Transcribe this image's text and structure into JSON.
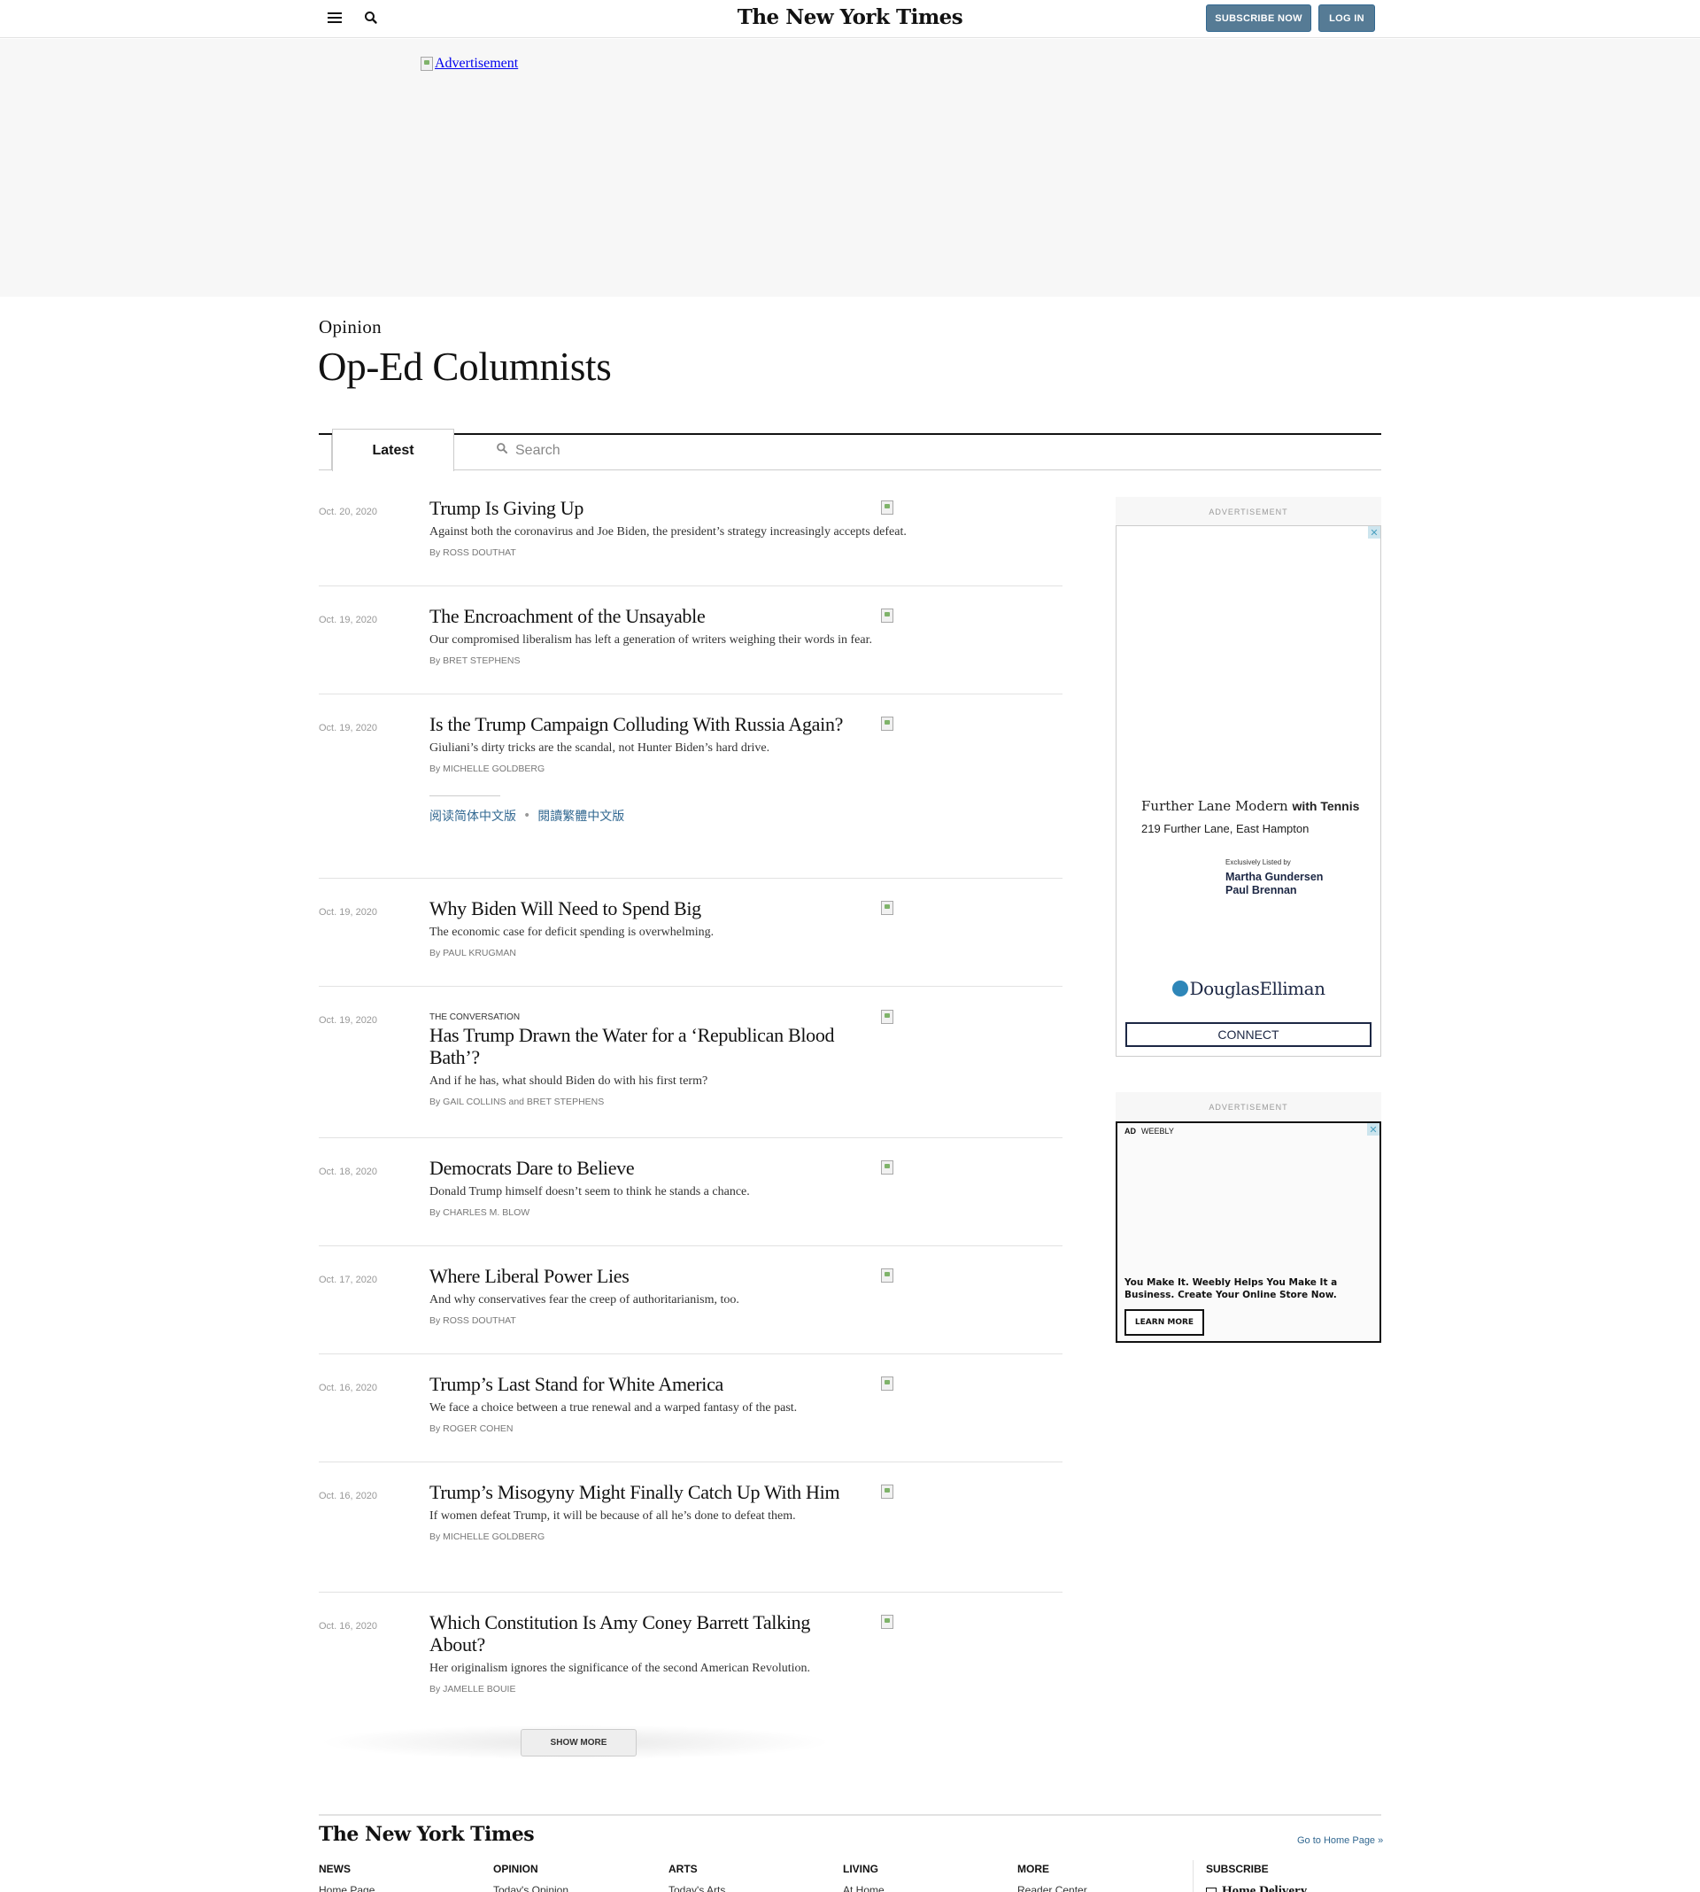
{
  "header": {
    "logo": "The New York Times",
    "subscribe_label": "SUBSCRIBE NOW",
    "login_label": "LOG IN"
  },
  "top_ad": {
    "alt": "Advertisement"
  },
  "section": {
    "kicker": "Opinion",
    "title": "Op-Ed Columnists"
  },
  "tabs": {
    "latest": "Latest",
    "search_placeholder": "Search"
  },
  "articles": [
    {
      "date": "Oct. 20, 2020",
      "label": "",
      "title": "Trump Is Giving Up",
      "summary": "Against both the coronavirus and Joe Biden, the president’s strategy increasingly accepts defeat.",
      "byline": "By ROSS DOUTHAT"
    },
    {
      "date": "Oct. 19, 2020",
      "label": "",
      "title": "The Encroachment of the Unsayable",
      "summary": "Our compromised liberalism has left a generation of writers weighing their words in fear.",
      "byline": "By BRET STEPHENS"
    },
    {
      "date": "Oct. 19, 2020",
      "label": "",
      "title": "Is the Trump Campaign Colluding With Russia Again?",
      "summary": "Giuliani’s dirty tricks are the scandal, not Hunter Biden’s hard drive.",
      "byline": "By MICHELLE GOLDBERG",
      "lang_simplified": "阅读简体中文版",
      "lang_traditional": "閱讀繁體中文版"
    },
    {
      "date": "Oct. 19, 2020",
      "label": "",
      "title": "Why Biden Will Need to Spend Big",
      "summary": "The economic case for deficit spending is overwhelming.",
      "byline": "By PAUL KRUGMAN"
    },
    {
      "date": "Oct. 19, 2020",
      "label": "THE CONVERSATION",
      "title": "Has Trump Drawn the Water for a ‘Republican Blood Bath’?",
      "summary": "And if he has, what should Biden do with his first term?",
      "byline": "By GAIL COLLINS and BRET STEPHENS"
    },
    {
      "date": "Oct. 18, 2020",
      "label": "",
      "title": "Democrats Dare to Believe",
      "summary": "Donald Trump himself doesn’t seem to think he stands a chance.",
      "byline": "By CHARLES M. BLOW"
    },
    {
      "date": "Oct. 17, 2020",
      "label": "",
      "title": "Where Liberal Power Lies",
      "summary": "And why conservatives fear the creep of authoritarianism, too.",
      "byline": "By ROSS DOUTHAT"
    },
    {
      "date": "Oct. 16, 2020",
      "label": "",
      "title": "Trump’s Last Stand for White America",
      "summary": "We face a choice between a true renewal and a warped fantasy of the past.",
      "byline": "By ROGER COHEN"
    },
    {
      "date": "Oct. 16, 2020",
      "label": "",
      "title": "Trump’s Misogyny Might Finally Catch Up With Him",
      "summary": "If women defeat Trump, it will be because of all he’s done to defeat them.",
      "byline": "By MICHELLE GOLDBERG"
    },
    {
      "date": "Oct. 16, 2020",
      "label": "",
      "title": "Which Constitution Is Amy Coney Barrett Talking About?",
      "summary": "Her originalism ignores the significance of the second American Revolution.",
      "byline": "By JAMELLE BOUIE"
    }
  ],
  "show_more_label": "SHOW MORE",
  "sidebar": {
    "ad_label": "ADVERTISEMENT",
    "ad1": {
      "headline": "Further Lane Modern",
      "headline_bold": "with Tennis",
      "address": "219 Further Lane, East Hampton",
      "listed_by": "Exclusively Listed by",
      "agent1": "Martha Gundersen",
      "agent2": "Paul Brennan",
      "brand": "DouglasElliman",
      "cta": "CONNECT",
      "close_icon": "✕"
    },
    "ad2": {
      "tag_ad": "AD",
      "tag_brand": "WEEBLY",
      "copy": "You Make It. Weebly Helps You Make It a Business. Create Your Online Store Now.",
      "cta": "LEARN MORE",
      "close_icon": "✕"
    }
  },
  "footer": {
    "logo": "The New York Times",
    "home_link": "Go to Home Page »",
    "columns": [
      {
        "title": "NEWS",
        "first_item": "Home Page"
      },
      {
        "title": "OPINION",
        "first_item": "Today's Opinion"
      },
      {
        "title": "ARTS",
        "first_item": "Today's Arts"
      },
      {
        "title": "LIVING",
        "first_item": "At Home"
      },
      {
        "title": "MORE",
        "first_item": "Reader Center"
      }
    ],
    "subscribe_title": "SUBSCRIBE",
    "subscribe_item": "Home Delivery"
  },
  "colors": {
    "button_blue": "#567b95",
    "link_blue": "#326891",
    "text": "#121212"
  }
}
